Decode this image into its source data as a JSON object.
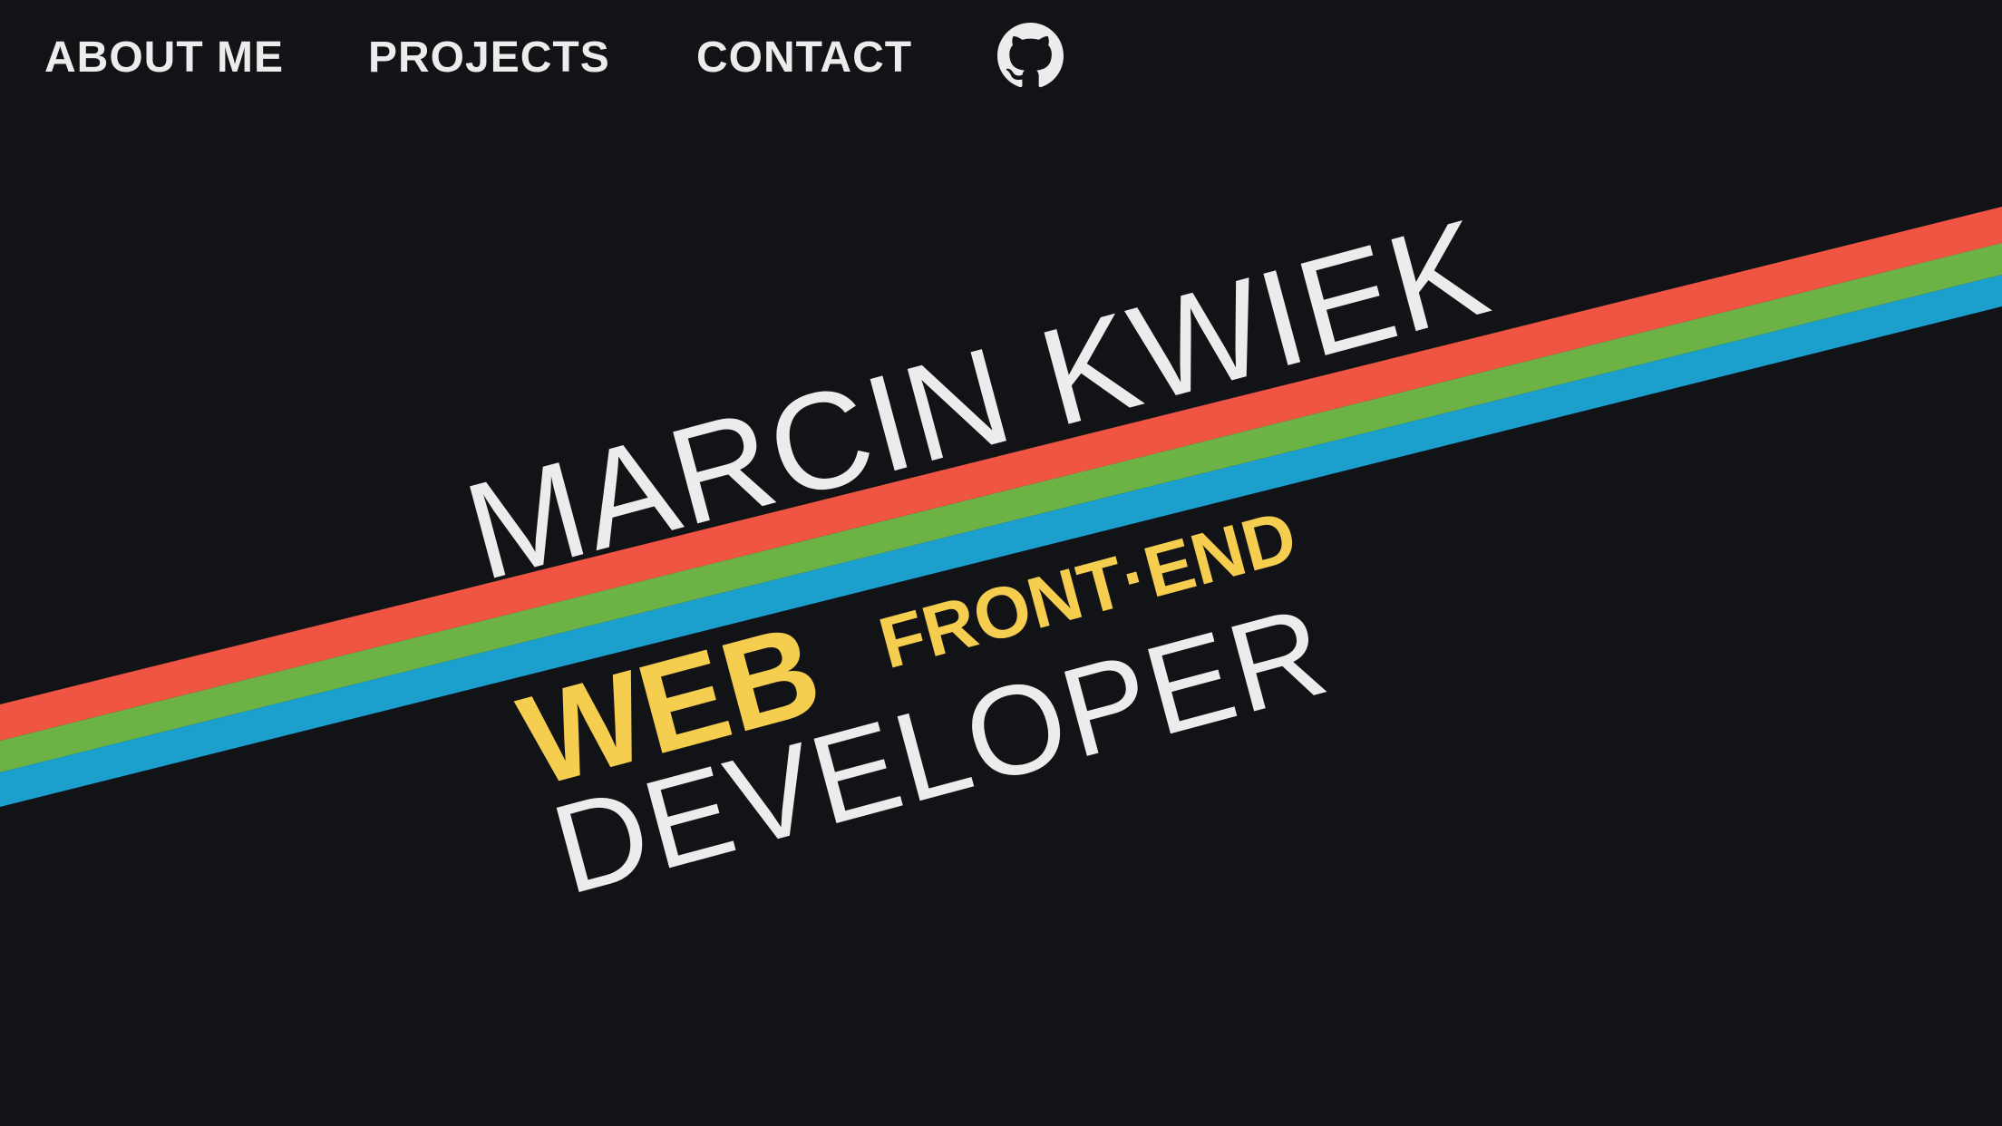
{
  "nav": {
    "about_label": "ABOUT ME",
    "projects_label": "PROJECTS",
    "contact_label": "CONTACT",
    "github_icon": "github-icon"
  },
  "hero": {
    "name": "MARCIN KWIEK",
    "role_web": "WEB",
    "role_frontend": "FRONT·END",
    "role_developer": "DEVELOPER"
  },
  "colors": {
    "background": "#121317",
    "text_light": "#ececec",
    "accent_yellow": "#f5cd4f",
    "stripe_red": "#f05543",
    "stripe_green": "#6cb244",
    "stripe_blue": "#1b9fcd"
  }
}
